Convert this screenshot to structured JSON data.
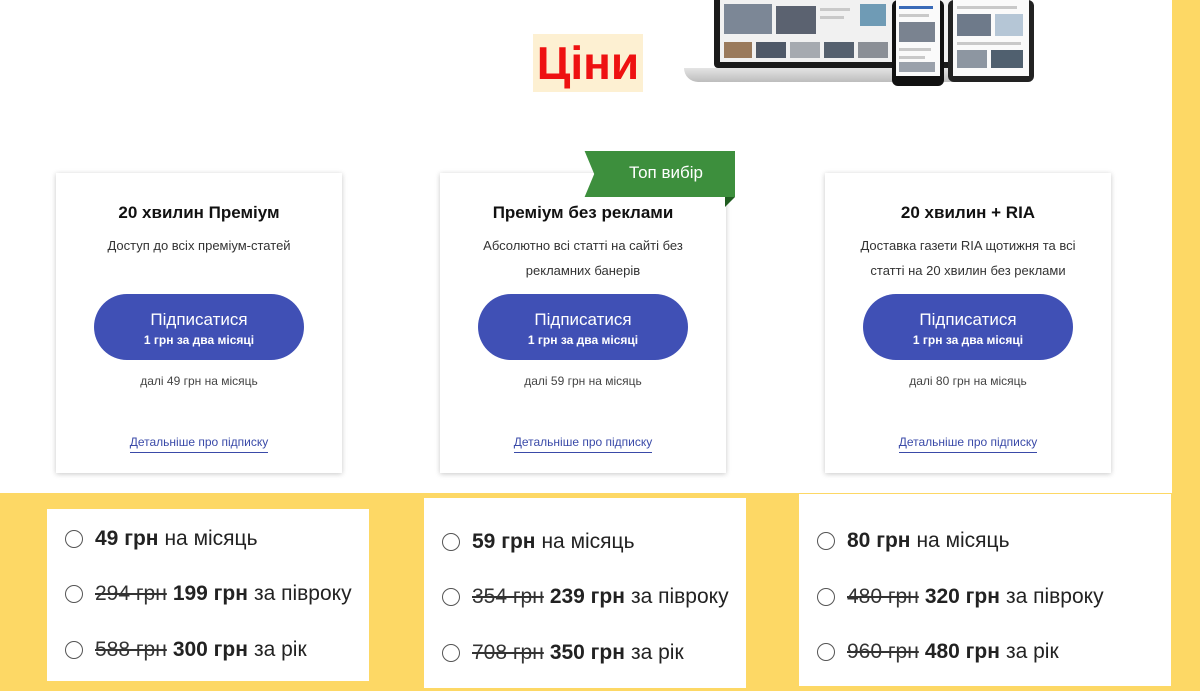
{
  "page_title": "Ціни",
  "colors": {
    "accent_yellow": "#fdd865",
    "button_blue": "#4050b5",
    "title_red": "#ee1111",
    "ribbon_green": "#3d8f3d"
  },
  "ribbon": "Топ вибір",
  "plans": [
    {
      "name": "20 хвилин Преміум",
      "description": "Доступ до всіх преміум-статей",
      "button_main": "Підписатися",
      "button_sub": "1 грн за два місяці",
      "after": "далі 49 грн на місяць",
      "more": "Детальніше про підписку",
      "options": [
        {
          "old": "",
          "price": "49 грн",
          "period": "на місяць"
        },
        {
          "old": "294 грн",
          "price": "199 грн",
          "period": "за півроку"
        },
        {
          "old": "588 грн",
          "price": "300 грн",
          "period": "за рік"
        }
      ]
    },
    {
      "name": "Преміум без реклами",
      "description": "Абсолютно всі статті на сайті без рекламних банерів",
      "button_main": "Підписатися",
      "button_sub": "1 грн за два місяці",
      "after": "далі 59 грн на місяць",
      "more": "Детальніше про підписку",
      "options": [
        {
          "old": "",
          "price": "59 грн",
          "period": "на місяць"
        },
        {
          "old": "354 грн",
          "price": "239 грн",
          "period": "за півроку"
        },
        {
          "old": "708 грн",
          "price": "350 грн",
          "period": "за рік"
        }
      ]
    },
    {
      "name": "20 хвилин + RIA",
      "description": "Доставка газети RIA щотижня та всі статті на 20 хвилин без реклами",
      "button_main": "Підписатися",
      "button_sub": "1 грн за два місяці",
      "after": "далі 80 грн на місяць",
      "more": "Детальніше про підписку",
      "options": [
        {
          "old": "",
          "price": "80 грн",
          "period": "на місяць"
        },
        {
          "old": "480 грн",
          "price": "320 грн",
          "period": "за півроку"
        },
        {
          "old": "960 грн",
          "price": "480 грн",
          "period": "за рік"
        }
      ]
    }
  ]
}
